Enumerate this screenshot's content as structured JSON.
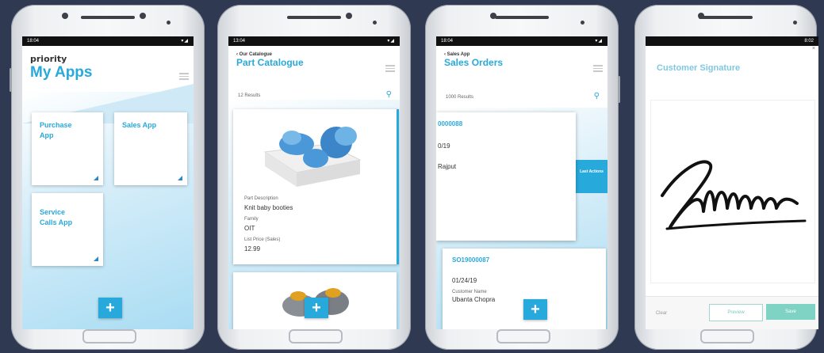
{
  "phones": [
    {
      "status_time": "18:04",
      "brand": "priority",
      "title": "My Apps",
      "tiles": [
        "Purchase App",
        "Sales App",
        "Service Calls App"
      ],
      "fab": "+"
    },
    {
      "status_time": "13:04",
      "crumb": "Our Catalogue",
      "title": "Part Catalogue",
      "results": "12 Results",
      "fields": [
        {
          "label": "Part Description",
          "value": "Knit baby booties"
        },
        {
          "label": "Family",
          "value": "OIT"
        },
        {
          "label": "List Price (Sales)",
          "value": "12.99"
        }
      ],
      "fab": "+"
    },
    {
      "status_time": "18:04",
      "crumb": "Sales App",
      "title": "Sales Orders",
      "results": "1000 Results",
      "card1": {
        "id": "0000088",
        "date": "0/19",
        "name": "Rajput"
      },
      "swipe_label": "Last Actions",
      "card2": {
        "id": "SO19000087",
        "date": "01/24/19",
        "customer_label": "Customer Name",
        "customer": "Ubanta Chopra"
      },
      "fab": "+"
    },
    {
      "status_time": "8:02",
      "title": "Customer Signature",
      "clear": "Clear",
      "preview": "Preview",
      "save": "Save"
    }
  ],
  "colors": {
    "accent": "#28a9db",
    "background": "#2f3a52",
    "save": "#7fd3c4"
  }
}
